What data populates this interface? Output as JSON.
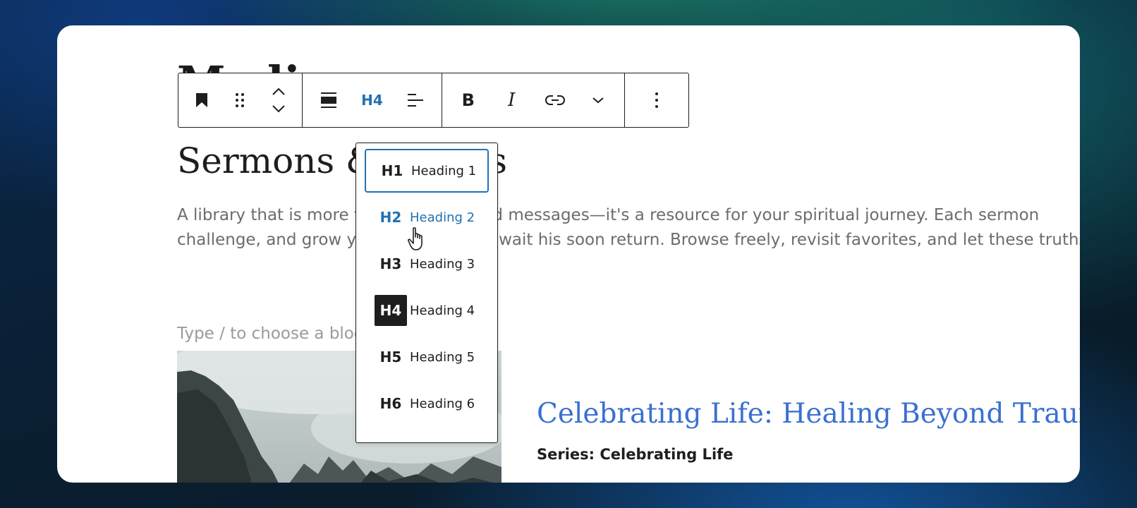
{
  "page": {
    "title_partial": "Medi",
    "heading": "Sermons & Videos",
    "intro_line1": "A library that is more than just recorded messages—it's a resource for your spiritual journey. Each sermon",
    "intro_line2": "challenge, and grow your faith as you await his soon return. Browse freely, revisit favorites, and let these truths",
    "block_placeholder": "Type / to choose a block"
  },
  "toolbar": {
    "block_type_icon": "bookmark-icon",
    "drag_icon": "drag-handle-icon",
    "move_icon": "move-up-down-icon",
    "align_icon": "align-block-icon",
    "heading_level_label": "H4",
    "text_align_icon": "align-left-icon",
    "bold_label": "B",
    "italic_label": "I",
    "link_icon": "link-icon",
    "more_rich_text_icon": "chevron-down-icon",
    "options_icon": "more-vertical-icon"
  },
  "heading_dropdown": {
    "options": [
      {
        "tag": "H1",
        "label": "Heading 1"
      },
      {
        "tag": "H2",
        "label": "Heading 2"
      },
      {
        "tag": "H3",
        "label": "Heading 3"
      },
      {
        "tag": "H4",
        "label": "Heading 4"
      },
      {
        "tag": "H5",
        "label": "Heading 5"
      },
      {
        "tag": "H6",
        "label": "Heading 6"
      }
    ],
    "focused": "H1",
    "hovered": "H2",
    "selected": "H4"
  },
  "post": {
    "title": "Celebrating Life: Healing Beyond Trauma",
    "series": "Series: Celebrating Life",
    "title_color": "#3b6fd1"
  },
  "colors": {
    "accent": "#2271b1",
    "text": "#1e1e1e"
  }
}
